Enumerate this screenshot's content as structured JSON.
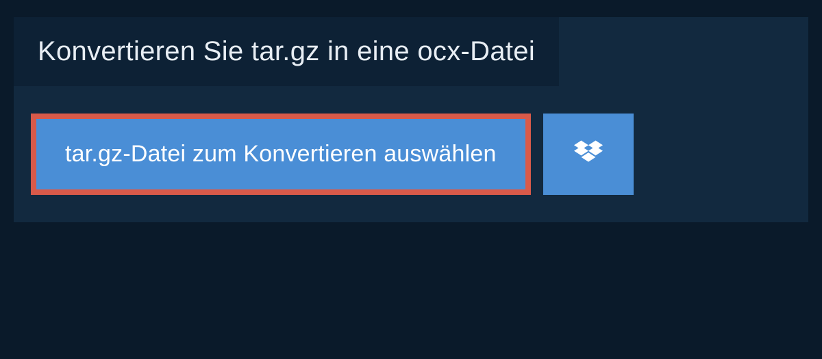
{
  "header": {
    "title": "Konvertieren Sie tar.gz in eine ocx-Datei"
  },
  "buttons": {
    "select_file_label": "tar.gz-Datei zum Konvertieren auswählen"
  },
  "colors": {
    "highlight_border": "#d85a4a",
    "button_bg": "#4a8ed6",
    "panel_bg": "#12293f",
    "header_bg": "#0d2135"
  }
}
